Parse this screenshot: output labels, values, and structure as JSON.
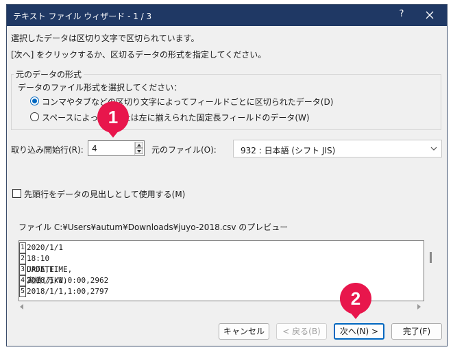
{
  "window": {
    "title": "テキスト ファイル ウィザード - 1 / 3",
    "help_label": "?"
  },
  "intro": {
    "line1": "選択したデータは区切り文字で区切られています。",
    "line2": "[次へ] をクリックするか、区切るデータの形式を指定してください。"
  },
  "source_format": {
    "group_title": "元のデータの形式",
    "prompt": "データのファイル形式を選択してください：",
    "options": [
      {
        "label": "コンマやタブなどの区切り文字によってフィールドごとに区切られたデータ(D)",
        "selected": true
      },
      {
        "label": "スペースによって右または左に揃えられた固定長フィールドのデータ(W)",
        "selected": false
      }
    ]
  },
  "start_row": {
    "label": "取り込み開始行(R):",
    "value": "4"
  },
  "file_origin": {
    "label": "元のファイル(O):",
    "value": "932 : 日本語 (シフト JIS)"
  },
  "header_checkbox": {
    "label": "先頭行をデータの見出しとして使用する(M)",
    "checked": false
  },
  "preview": {
    "caption": "ファイル C:¥Users¥autum¥Downloads¥juyo-2018.csv のプレビュー",
    "rows": [
      {
        "num": "1",
        "text": "2020/1/1 18:10 UPDATE"
      },
      {
        "num": "2",
        "text": ""
      },
      {
        "num": "3",
        "text": "DATE,TIME,実績(万kW)"
      },
      {
        "num": "4",
        "text": "2018/1/1,0:00,2962"
      },
      {
        "num": "5",
        "text": "2018/1/1,1:00,2797"
      }
    ]
  },
  "buttons": {
    "cancel": "キャンセル",
    "back": "< 戻る(B)",
    "next": "次へ(N) >",
    "finish": "完了(F)"
  },
  "annotations": {
    "badge1": "1",
    "badge2": "2"
  },
  "colors": {
    "titlebar": "#1f3864",
    "accent": "#0067c0",
    "badge": "#e8164c"
  }
}
